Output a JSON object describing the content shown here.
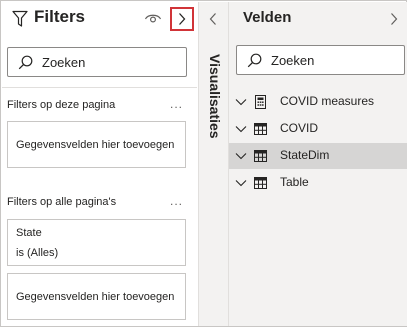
{
  "filters_pane": {
    "title": "Filters",
    "search_placeholder": "Zoeken",
    "page_section_title": "Filters op deze pagina",
    "page_section_more": "...",
    "page_add_fields": "Gegevensvelden hier toevoegen",
    "all_pages_section_title": "Filters op alle pagina's",
    "all_pages_section_more": "...",
    "filter_card": {
      "field": "State",
      "condition": "is (Alles)"
    },
    "all_pages_add_fields": "Gegevensvelden hier toevoegen",
    "highlight_color": "#d13438"
  },
  "visualizations_pane": {
    "label": "Visualisaties"
  },
  "fields_pane": {
    "title": "Velden",
    "search_placeholder": "Zoeken",
    "tables": [
      {
        "label": "COVID measures",
        "icon": "calculator-icon",
        "selected": false
      },
      {
        "label": "COVID",
        "icon": "table-icon",
        "selected": false
      },
      {
        "label": "StateDim",
        "icon": "table-icon",
        "selected": true
      },
      {
        "label": "Table",
        "icon": "table-icon",
        "selected": false
      }
    ]
  }
}
